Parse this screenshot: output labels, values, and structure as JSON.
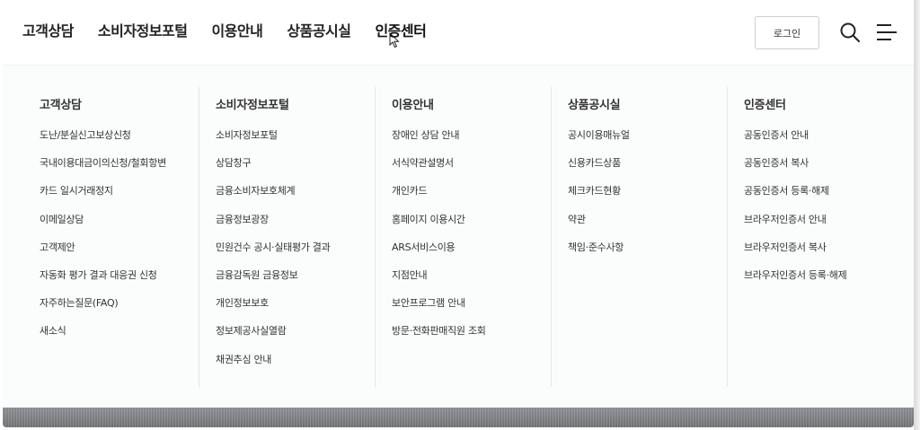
{
  "gnb": {
    "items": [
      "고객상담",
      "소비자정보포털",
      "이용안내",
      "상품공시실",
      "인증센터"
    ],
    "active_index": 4
  },
  "header": {
    "login_label": "로그인",
    "search_icon": "search-icon",
    "menu_icon": "hamburger-menu-icon"
  },
  "mega_menu": {
    "columns": [
      {
        "title": "고객상담",
        "items": [
          "도난/분실신고보상신청",
          "국내이용대금이의신청/철회항변",
          "카드 일시거래정지",
          "이메일상담",
          "고객제안",
          "자동화 평가 결과 대응권 신청",
          "자주하는질문(FAQ)",
          "새소식"
        ]
      },
      {
        "title": "소비자정보포털",
        "items": [
          "소비자정보포털",
          "상담창구",
          "금융소비자보호체계",
          "금융정보광장",
          "민원건수 공시·실태평가 결과",
          "금융감독원 금융정보",
          "개인정보보호",
          "정보제공사실열람",
          "채권추심 안내"
        ]
      },
      {
        "title": "이용안내",
        "items": [
          "장애인 상담 안내",
          "서식약관설명서",
          "개인카드",
          "홈페이지 이용시간",
          "ARS서비스이용",
          "지점안내",
          "보안프로그램 안내",
          "방문·전화판매직원 조회"
        ]
      },
      {
        "title": "상품공시실",
        "items": [
          "공시이용매뉴얼",
          "신용카드상품",
          "체크카드현황",
          "약관",
          "책임·준수사항"
        ]
      },
      {
        "title": "인증센터",
        "items": [
          "공동인증서 안내",
          "공동인증서 복사",
          "공동인증서 등록·해제",
          "브라우저인증서 안내",
          "브라우저인증서 복사",
          "브라우저인증서 등록·해제"
        ]
      }
    ]
  },
  "colors": {
    "active_highlight": "#ffe23a",
    "panel_bg": "#fbfcfc",
    "divider": "#e2e4e6",
    "bottom_bar": "#7b7d80"
  }
}
